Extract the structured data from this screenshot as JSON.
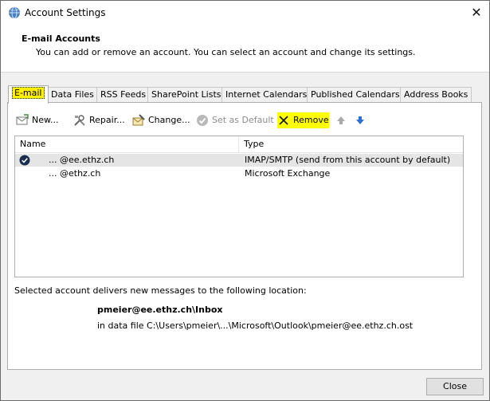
{
  "window": {
    "title": "Account Settings",
    "close_glyph": "✕"
  },
  "header": {
    "title": "E-mail Accounts",
    "subtitle": "You can add or remove an account. You can select an account and change its settings."
  },
  "tabs": [
    {
      "label": "E-mail"
    },
    {
      "label": "Data Files"
    },
    {
      "label": "RSS Feeds"
    },
    {
      "label": "SharePoint Lists"
    },
    {
      "label": "Internet Calendars"
    },
    {
      "label": "Published Calendars"
    },
    {
      "label": "Address Books"
    }
  ],
  "toolbar": {
    "new_label": "New...",
    "repair_label": "Repair...",
    "change_label": "Change...",
    "default_label": "Set as Default",
    "remove_label": "Remove",
    "highlight_color": "#ffff00"
  },
  "accounts": {
    "headers": {
      "name": "Name",
      "type": "Type"
    },
    "rows": [
      {
        "name": "...  @ee.ethz.ch",
        "type": "IMAP/SMTP (send from this account by default)",
        "selected": true
      },
      {
        "name": "...  @ethz.ch",
        "type": "Microsoft Exchange",
        "selected": false
      }
    ]
  },
  "location": {
    "label": "Selected account delivers new messages to the following location:",
    "folder": "pmeier@ee.ethz.ch\\Inbox",
    "file": "in data file C:\\Users\\pmeier\\...\\Microsoft\\Outlook\\pmeier@ee.ethz.ch.ost"
  },
  "footer": {
    "close_label": "Close"
  }
}
